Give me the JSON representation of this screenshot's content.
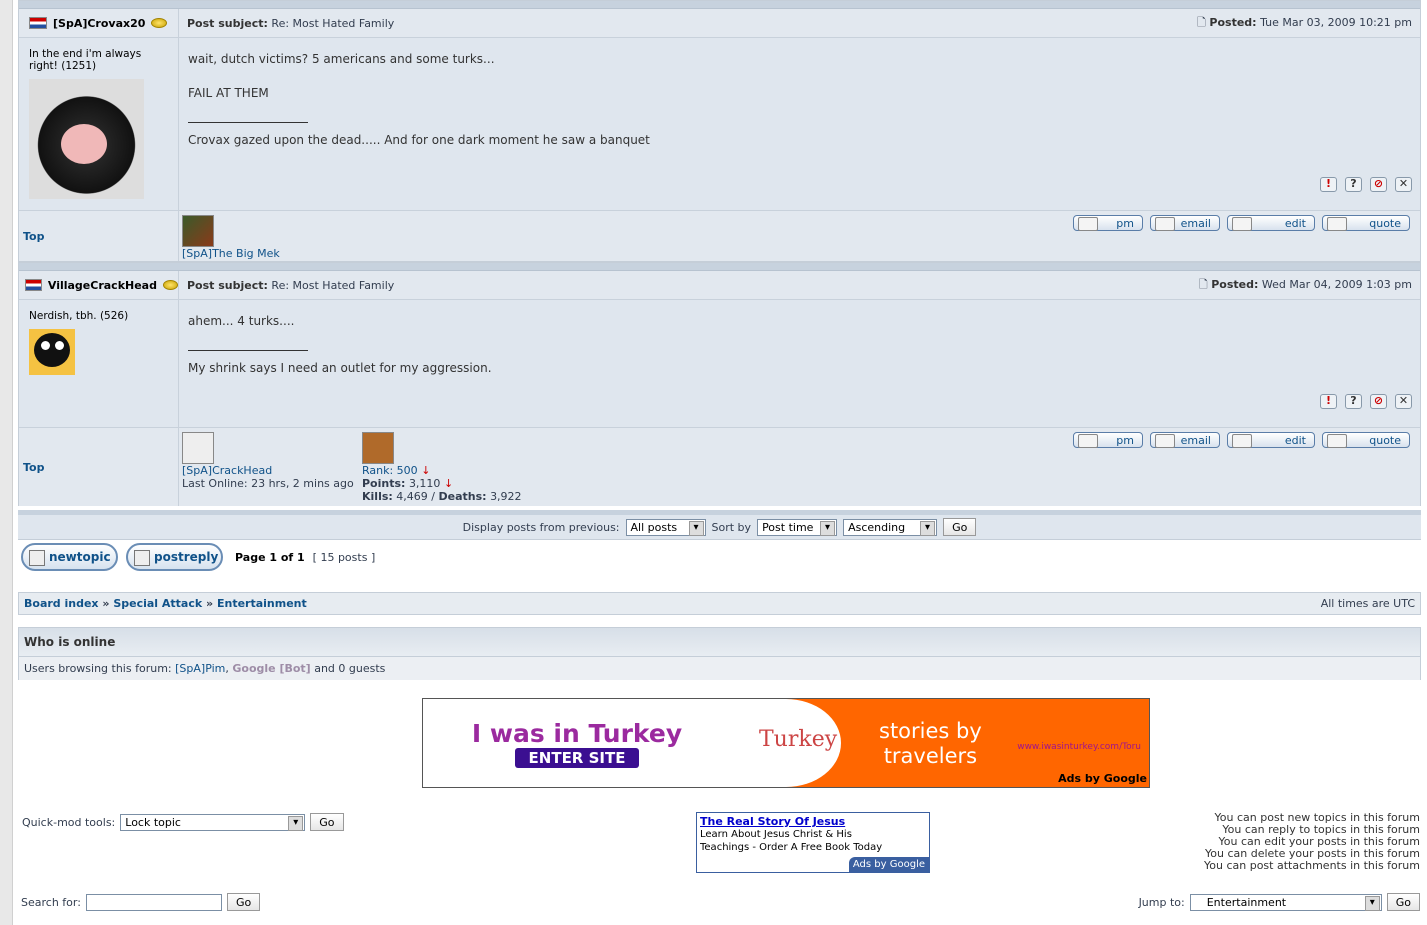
{
  "posts": [
    {
      "author": "[SpA]Crovax20",
      "subject_label": "Post subject:",
      "subject": "Re: Most Hated Family",
      "posted_label": "Posted:",
      "posted": "Tue Mar 03, 2009 10:21 pm",
      "profile_text": "In the end i'm always right! (1251)",
      "lines": [
        "wait, dutch victims? 5 americans and some turks...",
        "FAIL AT THEM"
      ],
      "signature": "Crovax gazed upon the dead..... And for one dark moment he saw a banquet",
      "top": "Top",
      "buddy": "[SpA]The Big Mek"
    },
    {
      "author": "VillageCrackHead",
      "subject_label": "Post subject:",
      "subject": "Re: Most Hated Family",
      "posted_label": "Posted:",
      "posted": "Wed Mar 04, 2009 1:03 pm",
      "profile_text": "Nerdish, tbh. (526)",
      "lines": [
        "ahem... 4 turks...."
      ],
      "signature": "My shrink says I need an outlet for my aggression.",
      "top": "Top",
      "user_link": "[SpA]CrackHead",
      "last_online": "Last Online: 23 hrs, 2 mins ago",
      "rank": "Rank: 500",
      "points_label": "Points:",
      "points": "3,110",
      "kills_label": "Kills:",
      "kills": "4,469",
      "deaths_label": "Deaths:",
      "deaths": "3,922"
    }
  ],
  "post_buttons": {
    "pm": "pm",
    "email": "email",
    "edit": "edit",
    "quote": "quote"
  },
  "options": {
    "display_label": "Display posts from previous:",
    "display_value": "All posts",
    "sort_label": "Sort by",
    "sort_value": "Post time",
    "order_value": "Ascending",
    "go": "Go"
  },
  "actions": {
    "new_topic": "newtopic",
    "post_reply": "postreply",
    "page": "Page 1 of 1",
    "posts_count": "[ 15 posts ]"
  },
  "breadcrumb": {
    "board_index": "Board index",
    "sep": "»",
    "forum": "Special Attack",
    "subforum": "Entertainment",
    "times": "All times are UTC"
  },
  "who_online": {
    "title": "Who is online",
    "browsing_label": "Users browsing this forum:",
    "user1": "[SpA]Pim",
    "user2": "Google [Bot]",
    "rest": "and 0 guests"
  },
  "ad_banner": {
    "headline": "I was in Turkey",
    "enter": "ENTER SITE",
    "logo": "Turkey",
    "tagline1": "stories by",
    "tagline2": "travelers",
    "url": "www.iwasinturkey.com/Toru",
    "ads_by": "Ads by Google"
  },
  "ad_text": {
    "title": "The Real Story Of Jesus",
    "line1": "Learn About Jesus Christ & His",
    "line2": "Teachings - Order A Free Book Today",
    "ads_by": "Ads by Google"
  },
  "quickmod": {
    "label": "Quick-mod tools:",
    "value": "Lock topic",
    "go": "Go"
  },
  "permissions": [
    "You can post new topics in this forum",
    "You can reply to topics in this forum",
    "You can edit your posts in this forum",
    "You can delete your posts in this forum",
    "You can post attachments in this forum"
  ],
  "search": {
    "label": "Search for:",
    "go": "Go"
  },
  "jump": {
    "label": "Jump to:",
    "value": "Entertainment",
    "go": "Go"
  },
  "colors": {
    "accent": "#105289",
    "orange": "#ff6600",
    "purple": "#9b2a9f"
  }
}
